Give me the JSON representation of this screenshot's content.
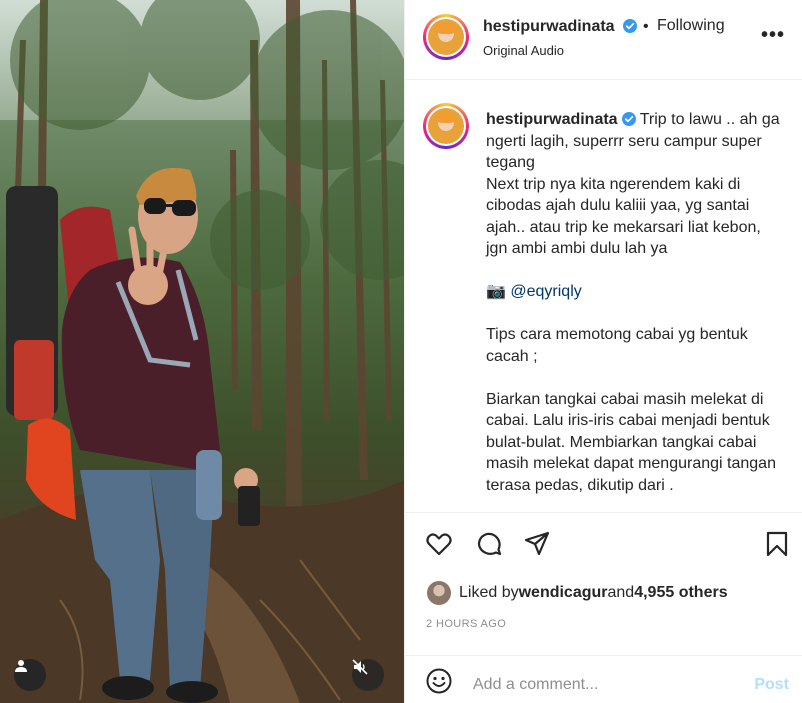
{
  "post": {
    "media": {
      "user_tag_icon": "person-icon",
      "mute_icon": "speaker-muted-icon"
    },
    "header": {
      "username": "hestipurwadinata",
      "separator": "•",
      "follow_status": "Following",
      "audio": "Original Audio",
      "more_icon": "•••"
    },
    "caption": {
      "username": "hestipurwadinata",
      "text_1": " Trip to lawu .. ah ga ngerti lagih, superrr seru campur super tegang\nNext trip nya kita ngerendem kaki di cibodas ajah dulu kaliii yaa, yg santai ajah.. atau trip ke mekarsari liat kebon, jgn ambi ambi dulu lah ya\n\n📷 ",
      "mention": "@eqyriqly",
      "text_2": "\n\nTips cara memotong cabai yg bentuk cacah ;\n\nBiarkan tangkai cabai masih melekat di cabai. Lalu iris-iris cabai menjadi bentuk bulat-bulat. Membiarkan tangkai cabai masih melekat dapat mengurangi tangan terasa pedas, dikutip dari ."
    },
    "likes": {
      "prefix": "Liked by ",
      "user": "wendicagur",
      "middle": " and ",
      "others": "4,955 others"
    },
    "timestamp": "2 HOURS AGO",
    "comment": {
      "placeholder": "Add a comment...",
      "post_label": "Post"
    }
  },
  "colors": {
    "verified": "#3897f0",
    "mention": "#00376b",
    "post_disabled": "#b2dffc",
    "muted_text": "#8e8e8e"
  }
}
